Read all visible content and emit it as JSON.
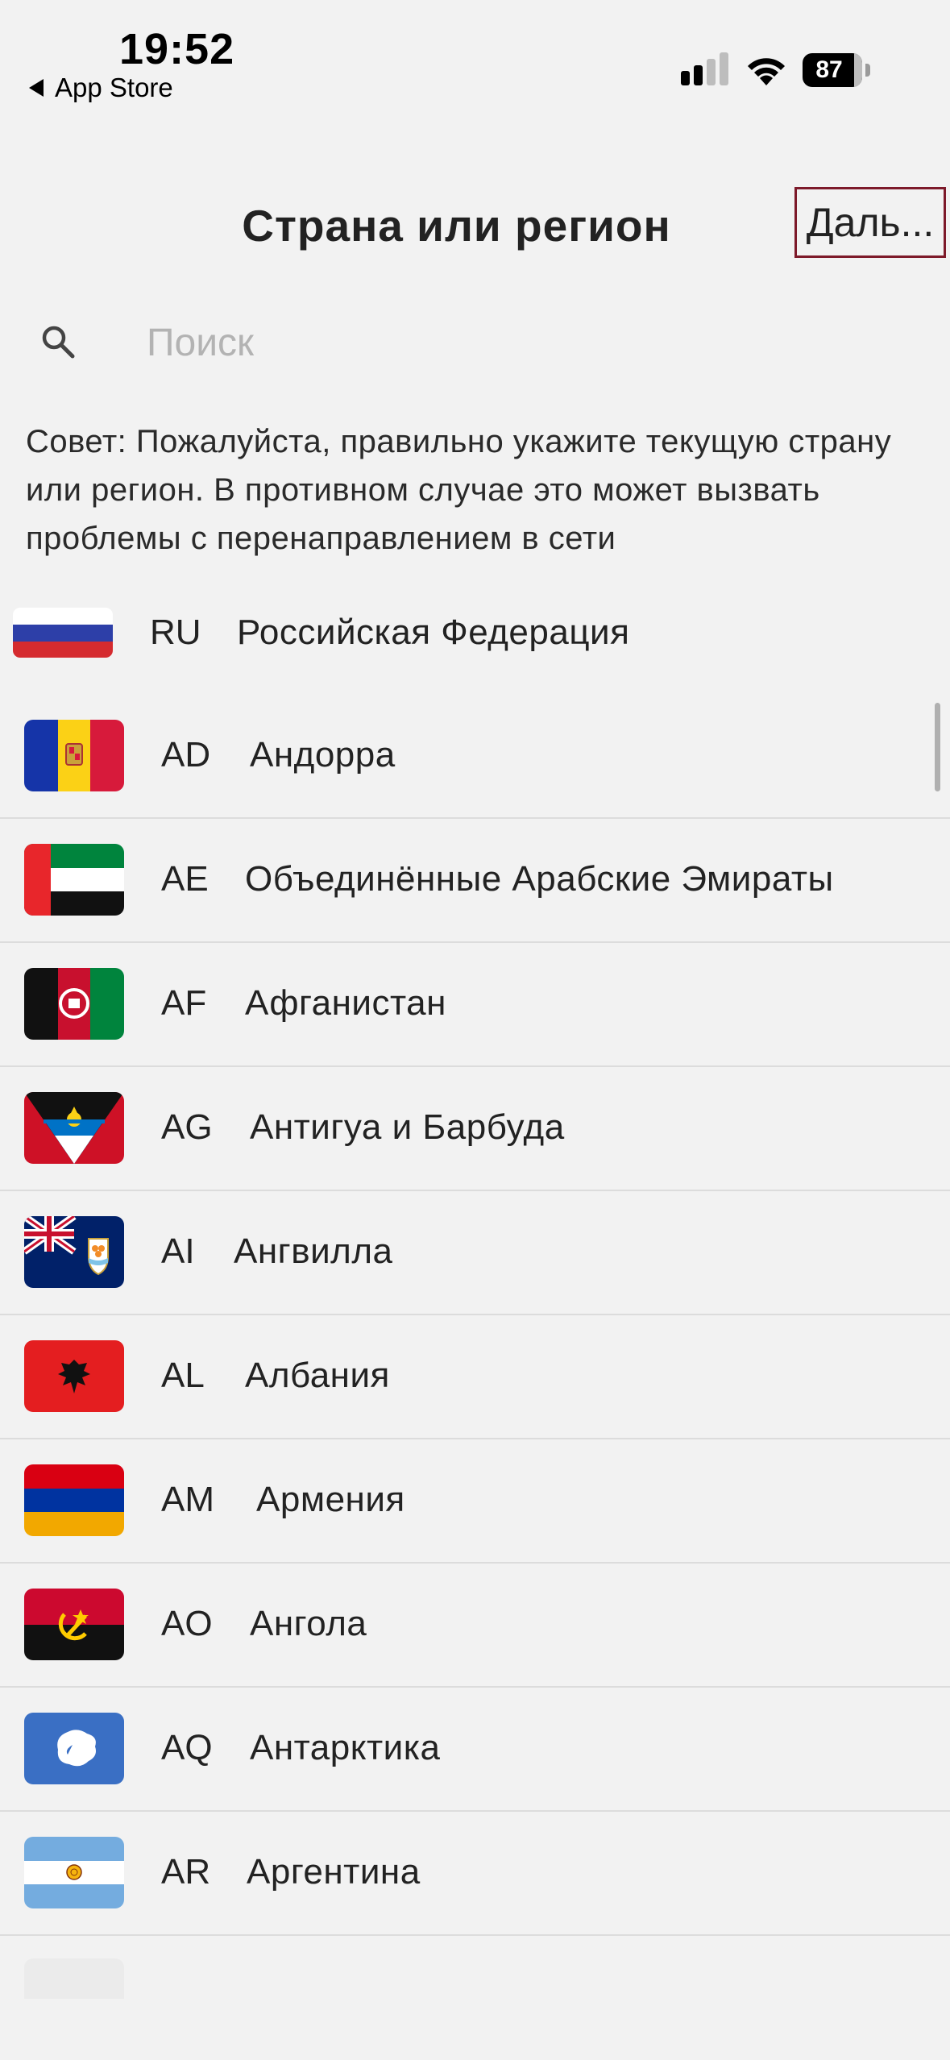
{
  "status_bar": {
    "time": "19:52",
    "back_app": "App Store",
    "battery": "87"
  },
  "header": {
    "title": "Страна или регион",
    "next_label": "Даль..."
  },
  "search": {
    "placeholder": "Поиск",
    "value": ""
  },
  "tip": "Совет: Пожалуйста, правильно укажите текущую страну или регион. В противном случае это может вызвать проблемы с перенаправлением в сети",
  "current": {
    "code": "RU",
    "name": "Российская Федерация"
  },
  "countries": [
    {
      "code": "AD",
      "name": "Андорра"
    },
    {
      "code": "AE",
      "name": "Объединённые Арабские Эмираты"
    },
    {
      "code": "AF",
      "name": "Афганистан"
    },
    {
      "code": "AG",
      "name": "Антигуа и Барбуда"
    },
    {
      "code": "AI",
      "name": "Ангвилла"
    },
    {
      "code": "AL",
      "name": "Албания"
    },
    {
      "code": "AM",
      "name": "Армения"
    },
    {
      "code": "AO",
      "name": "Ангола"
    },
    {
      "code": "AQ",
      "name": "Антарктика"
    },
    {
      "code": "AR",
      "name": "Аргентина"
    }
  ],
  "colors": {
    "background": "#f2f2f2",
    "divider": "#dcdcdc",
    "highlight_border": "#7d1a2a",
    "placeholder": "#b3b3b3"
  }
}
